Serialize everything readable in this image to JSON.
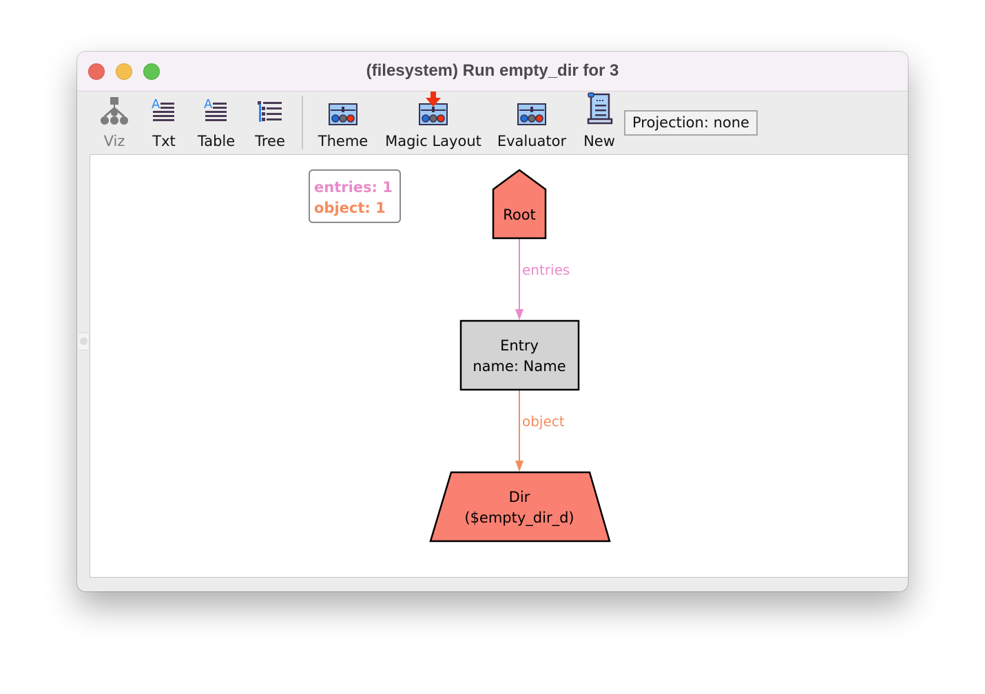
{
  "window": {
    "title": "(filesystem) Run empty_dir for 3"
  },
  "toolbar": {
    "buttons": [
      {
        "label": "Viz",
        "icon": "viz-graph-icon",
        "enabled": false
      },
      {
        "label": "Txt",
        "icon": "text-icon",
        "enabled": true
      },
      {
        "label": "Table",
        "icon": "table-icon",
        "enabled": true
      },
      {
        "label": "Tree",
        "icon": "tree-icon",
        "enabled": true
      },
      {
        "label": "Theme",
        "icon": "theme-icon",
        "enabled": true
      },
      {
        "label": "Magic Layout",
        "icon": "magic-layout-icon",
        "enabled": true
      },
      {
        "label": "Evaluator",
        "icon": "evaluator-icon",
        "enabled": true
      },
      {
        "label": "New",
        "icon": "new-scroll-icon",
        "enabled": true
      }
    ],
    "projection_label": "Projection: none"
  },
  "legend": {
    "items": [
      {
        "text": "entries: 1",
        "color": "#e98bc9"
      },
      {
        "text": "object: 1",
        "color": "#f48c5e"
      }
    ]
  },
  "graph": {
    "nodes": [
      {
        "id": "root",
        "lines": [
          "Root"
        ],
        "shape": "house",
        "fill": "#fa8072"
      },
      {
        "id": "entry",
        "lines": [
          "Entry",
          "name: Name"
        ],
        "shape": "box",
        "fill": "#d3d3d3"
      },
      {
        "id": "dir",
        "lines": [
          "Dir",
          "($empty_dir_d)"
        ],
        "shape": "trapezium",
        "fill": "#fa8072"
      }
    ],
    "edges": [
      {
        "from": "root",
        "to": "entry",
        "label": "entries",
        "color": "#e98bc9"
      },
      {
        "from": "entry",
        "to": "dir",
        "label": "object",
        "color": "#f48c5e"
      }
    ]
  }
}
